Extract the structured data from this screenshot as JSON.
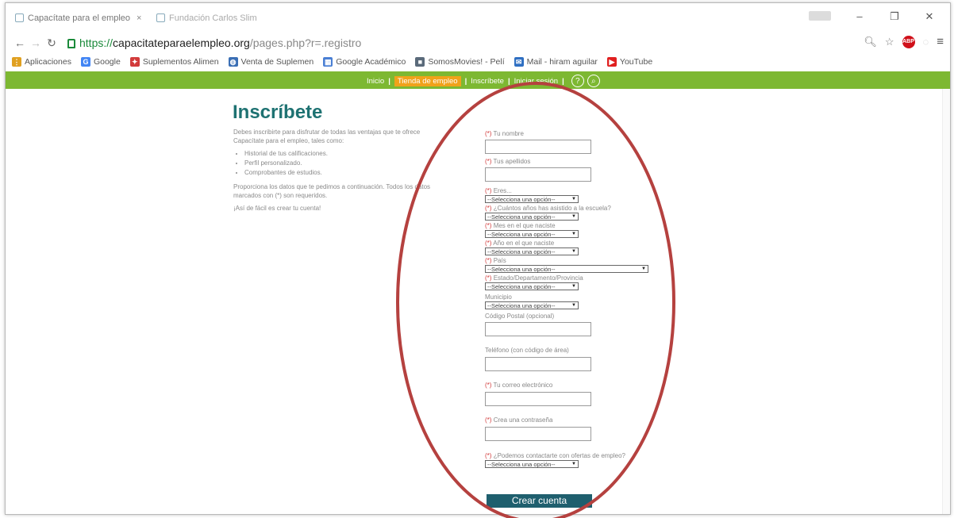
{
  "browser": {
    "tabs": [
      {
        "label": "Capacítate para el empleo"
      },
      {
        "label": "Fundación Carlos Slim"
      }
    ],
    "url_https": "https://",
    "url_domain": "capacitateparaelempleo.org",
    "url_path": "/pages.php?r=.registro",
    "bookmarks": [
      {
        "label": "Aplicaciones",
        "icon": "apps-icon",
        "color": "#e0a020"
      },
      {
        "label": "Google",
        "icon": "google-icon",
        "color": "#4285f4"
      },
      {
        "label": "Suplementos Alimen",
        "icon": "bookmark-icon",
        "color": "#d23b3b"
      },
      {
        "label": "Venta de Suplemen",
        "icon": "globe-icon",
        "color": "#3b6fb5"
      },
      {
        "label": "Google Académico",
        "icon": "scholar-icon",
        "color": "#4a7fd4"
      },
      {
        "label": "SomosMovies! - Pelí",
        "icon": "folder-icon",
        "color": "#5a6a7a"
      },
      {
        "label": "Mail - hiram aguilar",
        "icon": "mail-icon",
        "color": "#2f6fc2"
      },
      {
        "label": "YouTube",
        "icon": "youtube-icon",
        "color": "#e01f1f"
      }
    ]
  },
  "site_nav": {
    "items": [
      "Inicio",
      "Tienda de empleo",
      "Inscríbete",
      "Iniciar sesión"
    ]
  },
  "page": {
    "title": "Inscríbete",
    "intro_1": "Debes inscribirte para disfrutar de todas las ventajas que te ofrece Capacítate para el empleo, tales como:",
    "benefits": [
      "Historial de tus calificaciones.",
      "Perfil personalizado.",
      "Comprobantes de estudios."
    ],
    "intro_2": "Proporciona los datos que te pedimos a continuación. Todos los datos marcados con (*) son requeridos.",
    "intro_3": "¡Así de fácil es crear tu cuenta!"
  },
  "form": {
    "req_mark": "(*)",
    "select_placeholder": "--Selecciona una opción--",
    "name_label": "Tu nombre",
    "lastname_label": "Tus apellidos",
    "sex_label": "Eres...",
    "school_years_label": "¿Cuántos años has asistido a la escuela?",
    "birth_month_label": "Mes en el que naciste",
    "birth_year_label": "Año en el que naciste",
    "country_label": "País",
    "state_label": "Estado/Departamento/Provincia",
    "municipality_label": "Municipio",
    "postal_label": "Código Postal (opcional)",
    "phone_label": "Teléfono (con código de área)",
    "email_label": "Tu correo electrónico",
    "password_label": "Crea una contraseña",
    "contact_label": "¿Podemos contactarte con ofertas de empleo?",
    "submit_label": "Crear cuenta"
  },
  "colors": {
    "nav_green": "#7db832",
    "title_teal": "#1e7272",
    "button_teal": "#1f5f6e",
    "annotation_red": "#b5413f"
  }
}
